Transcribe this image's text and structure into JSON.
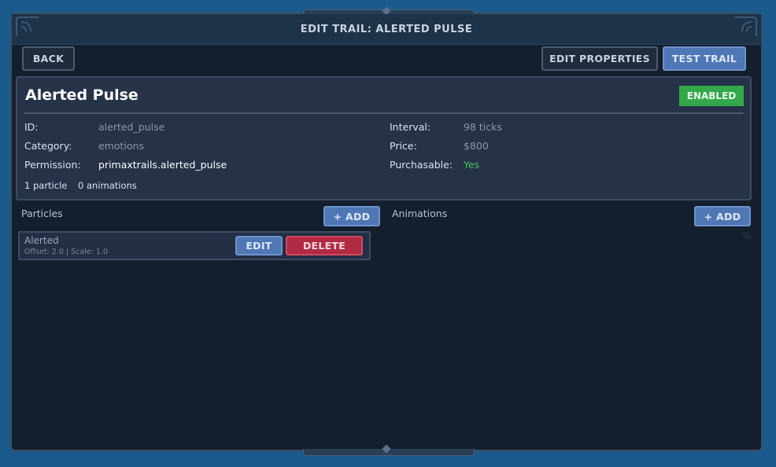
{
  "window": {
    "title": "EDIT TRAIL: ALERTED PULSE"
  },
  "toolbar": {
    "back_label": "BACK",
    "edit_properties_label": "EDIT PROPERTIES",
    "test_trail_label": "TEST TRAIL"
  },
  "trail": {
    "name": "Alerted Pulse",
    "status": "ENABLED",
    "fields_left": [
      {
        "label": "ID:",
        "value": "alerted_pulse"
      },
      {
        "label": "Category:",
        "value": "emotions"
      },
      {
        "label": "Permission:",
        "value": "primaxtrails.alerted_pulse"
      }
    ],
    "fields_right": [
      {
        "label": "Interval:",
        "value": "98 ticks"
      },
      {
        "label": "Price:",
        "value": "$800"
      },
      {
        "label": "Purchasable:",
        "value": "Yes"
      }
    ],
    "particle_count": "1 particle",
    "animation_count": "0 animations"
  },
  "particles_section": {
    "label": "Particles",
    "add_label": "+ ADD",
    "items": [
      {
        "name": "Alerted",
        "meta": "Offset: 2.0 | Scale: 1.0",
        "edit_label": "EDIT",
        "delete_label": "DELETE"
      }
    ]
  },
  "animations_section": {
    "label": "Animations",
    "add_label": "+ ADD",
    "items": []
  },
  "colors": {
    "background": "#1b5a8c",
    "panel": "#141f2d",
    "enabled_badge": "#32a84a",
    "accent_blue": "#4f76b5",
    "danger_red": "#b02a44",
    "yes_green": "#4cc457"
  },
  "icons": {
    "corner_ornament": "corner-ornament-icon",
    "drag_handle": "drag-handle-icon"
  }
}
